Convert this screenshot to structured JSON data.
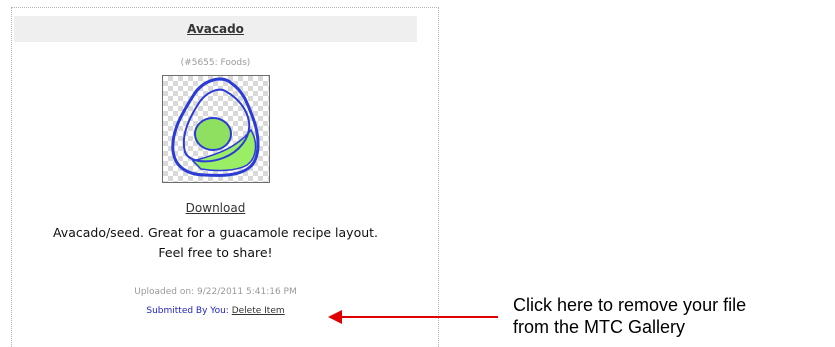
{
  "item": {
    "title": "Avacado",
    "meta": "(#5655: Foods)",
    "thumbnail_icon": "avocado-image",
    "download_label": "Download",
    "description_line1": "Avacado/seed. Great for a guacamole recipe layout.",
    "description_line2": "Feel free to share!",
    "uploaded": "Uploaded on: 9/22/2011 5:41:16 PM",
    "submitted_label": "Submitted By You:",
    "delete_label": "Delete Item"
  },
  "annotation": {
    "line1": "Click here to remove your file",
    "line2": "from the MTC Gallery",
    "arrow_color": "#e00000"
  },
  "colors": {
    "avocado_flesh": "#99ee66",
    "outline": "#2b3bd6",
    "link_blue": "#2424c8"
  }
}
